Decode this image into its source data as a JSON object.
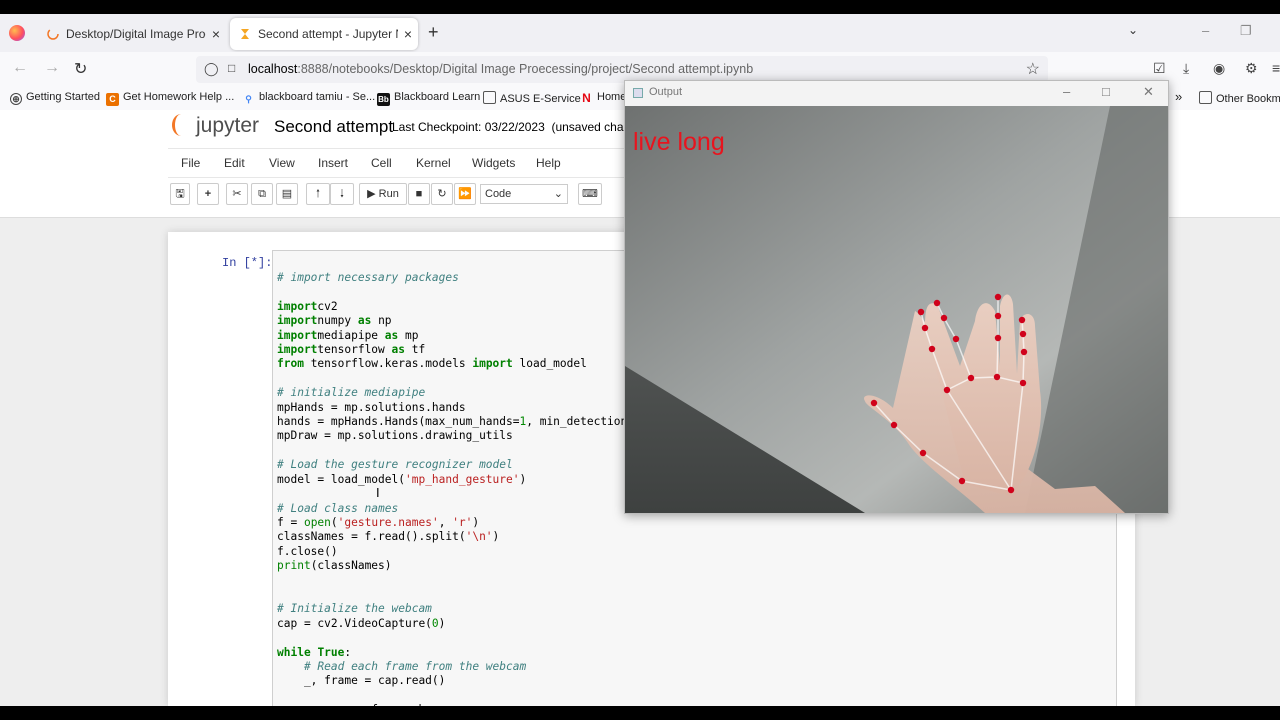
{
  "browser": {
    "tabs": [
      {
        "title": "Desktop/Digital Image Proecessing/project/",
        "active": false
      },
      {
        "title": "Second attempt - Jupyter Notebook",
        "active": true
      }
    ],
    "new_tab": "+",
    "close_glyph": "×",
    "url_host": "localhost",
    "url_path": ":8888/notebooks/Desktop/Digital Image Proecessing/project/Second attempt.ipynb",
    "bookmarks": [
      {
        "label": "Getting Started",
        "icon": "globe-icon"
      },
      {
        "label": "Get Homework Help ...",
        "icon": "chegg-icon"
      },
      {
        "label": "blackboard tamiu - Se...",
        "icon": "search-icon"
      },
      {
        "label": "Blackboard Learn",
        "icon": "blackboard-icon"
      },
      {
        "label": "ASUS E-Service",
        "icon": "folder-icon"
      },
      {
        "label": "Home",
        "icon": "netflix-icon"
      },
      {
        "label": "Other Bookmarks",
        "icon": "folder-icon"
      }
    ],
    "accent": "#0060df"
  },
  "jupyter": {
    "logo_text": "jupyter",
    "notebook_title": "Second attempt",
    "checkpoint": "Last Checkpoint: 03/22/2023",
    "status": "(unsaved change",
    "menu": [
      "File",
      "Edit",
      "View",
      "Insert",
      "Cell",
      "Kernel",
      "Widgets",
      "Help"
    ],
    "toolbar": {
      "run_label": "Run",
      "cell_type": "Code"
    },
    "cell_prompt": "In [*]:",
    "brand_color": "#f37726"
  },
  "code_lines": [
    {
      "t": "cm",
      "s": "# import necessary packages"
    },
    {
      "t": "",
      "s": ""
    },
    {
      "t": "mix",
      "p": [
        [
          "kw",
          "import"
        ],
        [
          "",
          "cv2"
        ]
      ]
    },
    {
      "t": "mix",
      "p": [
        [
          "kw",
          "import"
        ],
        [
          "",
          "numpy "
        ],
        [
          "kw",
          "as"
        ],
        [
          "",
          " np"
        ]
      ]
    },
    {
      "t": "mix",
      "p": [
        [
          "kw",
          "import"
        ],
        [
          "",
          "mediapipe "
        ],
        [
          "kw",
          "as"
        ],
        [
          "",
          " mp"
        ]
      ]
    },
    {
      "t": "mix",
      "p": [
        [
          "kw",
          "import"
        ],
        [
          "",
          "tensorflow "
        ],
        [
          "kw",
          "as"
        ],
        [
          "",
          " tf"
        ]
      ]
    },
    {
      "t": "mix",
      "p": [
        [
          "kw",
          "from"
        ],
        [
          "",
          " tensorflow.keras.models "
        ],
        [
          "kw",
          "import"
        ],
        [
          "",
          " load_model"
        ]
      ]
    },
    {
      "t": "",
      "s": ""
    },
    {
      "t": "cm",
      "s": "# initialize mediapipe"
    },
    {
      "t": "",
      "s": "mpHands = mp.solutions.hands"
    },
    {
      "t": "mix",
      "p": [
        [
          "",
          "hands = mpHands.Hands(max_num_hands="
        ],
        [
          "nm",
          "1"
        ],
        [
          "",
          ", min_detection_"
        ]
      ]
    },
    {
      "t": "",
      "s": "mpDraw = mp.solutions.drawing_utils"
    },
    {
      "t": "",
      "s": ""
    },
    {
      "t": "cm",
      "s": "# Load the gesture recognizer model"
    },
    {
      "t": "mix",
      "p": [
        [
          "",
          "model = load_model("
        ],
        [
          "st",
          "'mp_hand_gesture'"
        ],
        [
          "",
          ")"
        ]
      ]
    },
    {
      "t": "",
      "s": ""
    },
    {
      "t": "cm",
      "s": "# Load class names"
    },
    {
      "t": "mix",
      "p": [
        [
          "",
          "f = "
        ],
        [
          "bi",
          "open"
        ],
        [
          "",
          "("
        ],
        [
          "st",
          "'gesture.names'"
        ],
        [
          "",
          ", "
        ],
        [
          "st",
          "'r'"
        ],
        [
          "",
          ")"
        ]
      ]
    },
    {
      "t": "mix",
      "p": [
        [
          "",
          "classNames = f.read().split("
        ],
        [
          "st",
          "'\\n'"
        ],
        [
          "",
          ")"
        ]
      ]
    },
    {
      "t": "",
      "s": "f.close()"
    },
    {
      "t": "mix",
      "p": [
        [
          "bi",
          "print"
        ],
        [
          "",
          "(classNames)"
        ]
      ]
    },
    {
      "t": "",
      "s": ""
    },
    {
      "t": "",
      "s": ""
    },
    {
      "t": "cm",
      "s": "# Initialize the webcam"
    },
    {
      "t": "mix",
      "p": [
        [
          "",
          "cap = cv2.VideoCapture("
        ],
        [
          "nm",
          "0"
        ],
        [
          "",
          ")"
        ]
      ]
    },
    {
      "t": "",
      "s": ""
    },
    {
      "t": "mix",
      "p": [
        [
          "kw",
          "while"
        ],
        [
          "",
          " "
        ],
        [
          "kw",
          "True"
        ],
        [
          "",
          ":"
        ]
      ]
    },
    {
      "t": "cm",
      "s": "    # Read each frame from the webcam"
    },
    {
      "t": "",
      "s": "    _, frame = cap.read()"
    },
    {
      "t": "",
      "s": ""
    },
    {
      "t": "",
      "s": "    x, y, c = frame.shape"
    }
  ],
  "output_window": {
    "title": "Output",
    "prediction": "live long",
    "prediction_color": "#e8141e",
    "landmark_color": "#d0021b"
  }
}
